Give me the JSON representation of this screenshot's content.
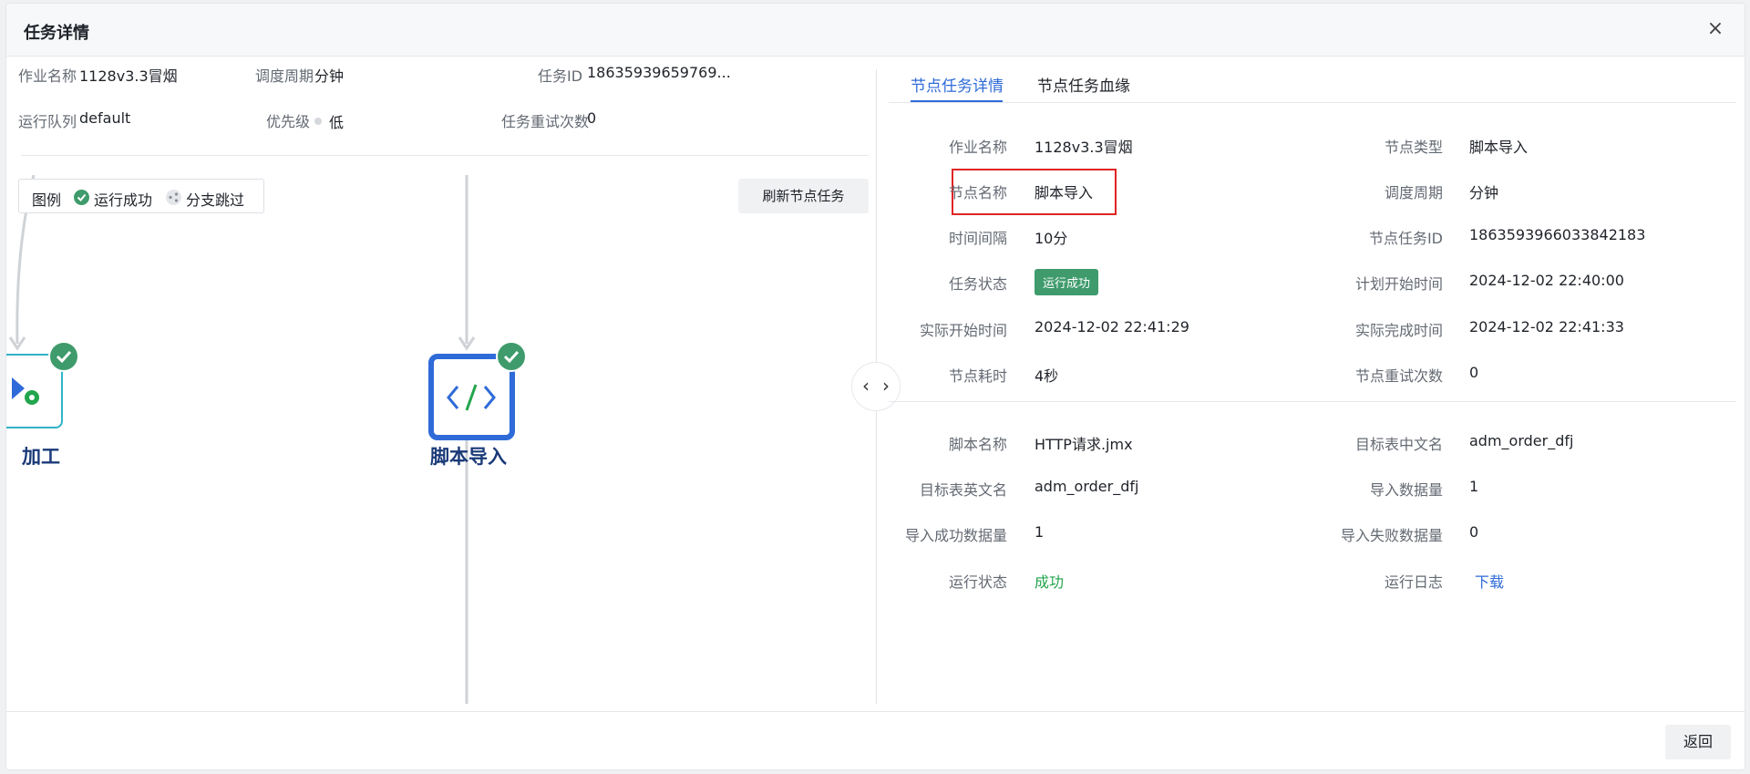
{
  "dialog": {
    "title": "任务详情",
    "close_glyph": "×"
  },
  "left_info": {
    "job_name_label": "作业名称",
    "job_name_value": "1128v3.3冒烟",
    "schedule_label": "调度周期",
    "schedule_value": "分钟",
    "task_id_label": "任务ID",
    "task_id_value": "18635939659769...",
    "queue_label": "运行队列",
    "queue_value": "default",
    "priority_label": "优先级",
    "priority_value": "低",
    "retry_label": "任务重试次数",
    "retry_value": "0"
  },
  "legend": {
    "title": "图例",
    "success": "运行成功",
    "skip": "分支跳过"
  },
  "refresh_label": "刷新节点任务",
  "nodes": [
    {
      "label": "加工",
      "icon": "process-gear-icon",
      "status": "success"
    },
    {
      "label": "脚本导入",
      "icon": "code-icon",
      "status": "success"
    }
  ],
  "tabs": {
    "detail": "节点任务详情",
    "lineage": "节点任务血缘"
  },
  "detail": {
    "job_name_label": "作业名称",
    "job_name_value": "1128v3.3冒烟",
    "node_type_label": "节点类型",
    "node_type_value": "脚本导入",
    "node_name_label": "节点名称",
    "node_name_value": "脚本导入",
    "schedule_label": "调度周期",
    "schedule_value": "分钟",
    "interval_label": "时间间隔",
    "interval_value": "10分",
    "node_task_id_label": "节点任务ID",
    "node_task_id_value": "1863593966033842183",
    "task_status_label": "任务状态",
    "task_status_value": "运行成功",
    "plan_start_label": "计划开始时间",
    "plan_start_value": "2024-12-02 22:40:00",
    "actual_start_label": "实际开始时间",
    "actual_start_value": "2024-12-02 22:41:29",
    "actual_end_label": "实际完成时间",
    "actual_end_value": "2024-12-02 22:41:33",
    "duration_label": "节点耗时",
    "duration_value": "4秒",
    "node_retry_label": "节点重试次数",
    "node_retry_value": "0",
    "script_name_label": "脚本名称",
    "script_name_value": "HTTP请求.jmx",
    "target_cn_label": "目标表中文名",
    "target_cn_value": "adm_order_dfj",
    "target_en_label": "目标表英文名",
    "target_en_value": "adm_order_dfj",
    "import_count_label": "导入数据量",
    "import_count_value": "1",
    "import_success_label": "导入成功数据量",
    "import_success_value": "1",
    "import_fail_label": "导入失败数据量",
    "import_fail_value": "0",
    "run_status_label": "运行状态",
    "run_status_value": "成功",
    "run_log_label": "运行日志",
    "run_log_value": "下载"
  },
  "footer": {
    "back_label": "返回"
  },
  "colors": {
    "accent": "#2f6bd8",
    "success": "#3f9b6c",
    "success_text": "#22a54c",
    "highlight": "#e02424"
  }
}
